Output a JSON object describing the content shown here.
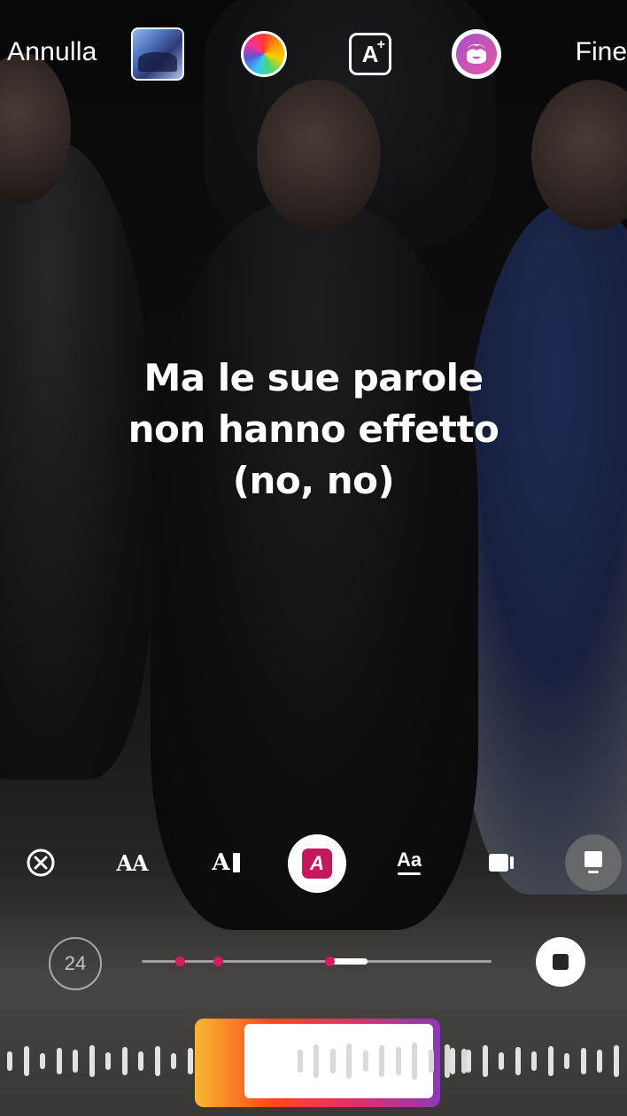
{
  "toolbar": {
    "cancel_label": "Annulla",
    "done_label": "Fine",
    "album_icon": "album-cover-icon",
    "color_icon": "color-wheel-icon",
    "text_effect_icon": "text-sparkle-icon",
    "text_effect_glyph": "A",
    "text_effect_sparkle": "+",
    "sticker_icon": "avatar-sticker-icon"
  },
  "lyrics": {
    "line1": "Ma le sue parole",
    "line2": "non hanno effetto",
    "line3": "(no, no)"
  },
  "style_picker": {
    "items": [
      {
        "icon": "close-icon"
      },
      {
        "icon": "font-size-icon",
        "label": "AA"
      },
      {
        "icon": "text-cursor-icon",
        "label": "A"
      },
      {
        "icon": "highlight-text-icon",
        "label": "A",
        "selected": true
      },
      {
        "icon": "font-style-icon",
        "label": "Aa"
      },
      {
        "icon": "video-icon"
      },
      {
        "icon": "card-icon"
      }
    ]
  },
  "timeline": {
    "duration_label": "24",
    "progress_fraction": 0.11,
    "markers_fraction": [
      0.11,
      0.22,
      0.53
    ]
  },
  "colors": {
    "accent_magenta": "#d81b60",
    "gradient_start": "#f7b733",
    "gradient_end": "#8a3ab9"
  }
}
